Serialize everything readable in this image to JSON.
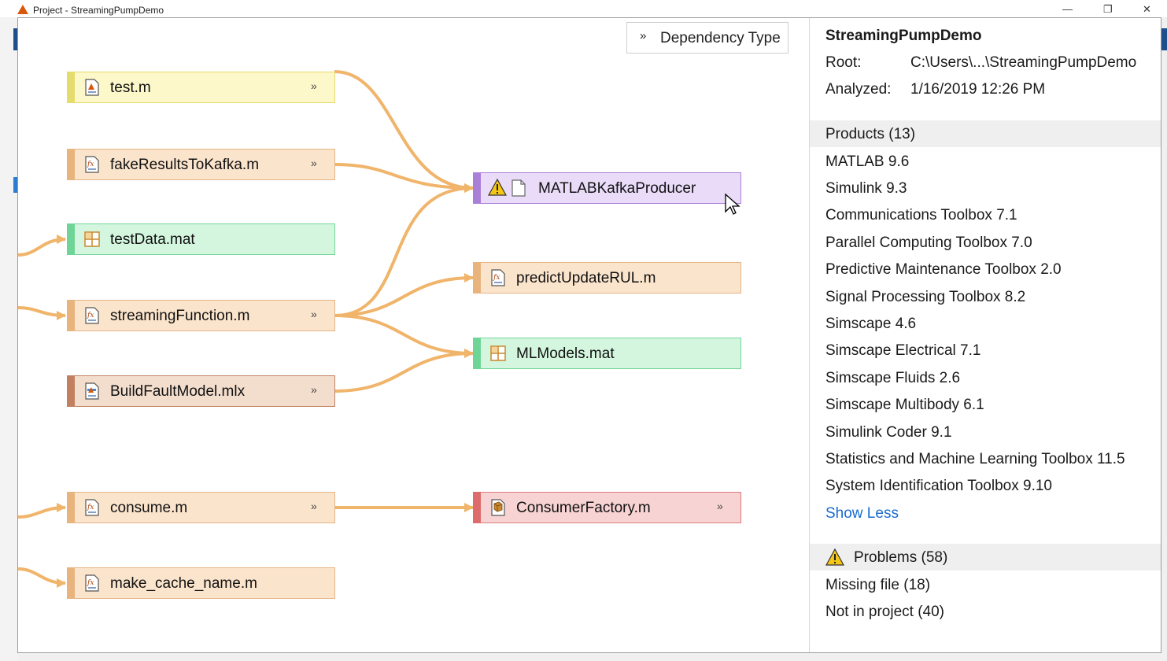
{
  "window": {
    "title": "Project - StreamingPumpDemo",
    "controls": [
      "—",
      "❐",
      "✕"
    ]
  },
  "toolbar": {
    "dependency_type_label": "Dependency Type"
  },
  "graph": {
    "nodes": [
      {
        "id": "test",
        "label": "test.m",
        "type": "script",
        "expandable": true
      },
      {
        "id": "fake",
        "label": "fakeResultsToKafka.m",
        "type": "function",
        "expandable": true
      },
      {
        "id": "testdata",
        "label": "testData.mat",
        "type": "mat",
        "expandable": false
      },
      {
        "id": "streaming",
        "label": "streamingFunction.m",
        "type": "function",
        "expandable": true
      },
      {
        "id": "buildfault",
        "label": "BuildFaultModel.mlx",
        "type": "livescript",
        "expandable": true
      },
      {
        "id": "consume",
        "label": "consume.m",
        "type": "function",
        "expandable": true
      },
      {
        "id": "makecache",
        "label": "make_cache_name.m",
        "type": "function",
        "expandable": false
      },
      {
        "id": "producer",
        "label": "MATLABKafkaProducer",
        "type": "missing",
        "expandable": false
      },
      {
        "id": "predict",
        "label": "predictUpdateRUL.m",
        "type": "function",
        "expandable": false
      },
      {
        "id": "mlmodels",
        "label": "MLModels.mat",
        "type": "mat",
        "expandable": false
      },
      {
        "id": "consumerfactory",
        "label": "ConsumerFactory.m",
        "type": "class",
        "expandable": true
      }
    ],
    "edges": [
      {
        "from": "test",
        "to": "producer"
      },
      {
        "from": "fake",
        "to": "producer"
      },
      {
        "from": "streaming",
        "to": "producer"
      },
      {
        "from": "streaming",
        "to": "predict"
      },
      {
        "from": "streaming",
        "to": "mlmodels"
      },
      {
        "from": "buildfault",
        "to": "mlmodels"
      },
      {
        "from": "consume",
        "to": "consumerfactory"
      },
      {
        "from": "(offscreen)",
        "to": "testdata"
      },
      {
        "from": "(offscreen)",
        "to": "streaming"
      },
      {
        "from": "(offscreen)",
        "to": "consume"
      },
      {
        "from": "(offscreen)",
        "to": "makecache"
      }
    ],
    "colors": {
      "edge": "#f0b46a",
      "script_bar": "#e4dc6c",
      "function_bar": "#e9b37e",
      "mat_bar": "#6fd596",
      "livescript_bar": "#c28060",
      "missing_bar": "#a97fd8",
      "class_bar": "#dd6d6d"
    }
  },
  "details": {
    "project_name": "StreamingPumpDemo",
    "root_label": "Root:",
    "root_value": "C:\\Users\\...\\StreamingPumpDemo",
    "analyzed_label": "Analyzed:",
    "analyzed_value": "1/16/2019 12:26 PM",
    "products_header": "Products (13)",
    "products": [
      "MATLAB 9.6",
      "Simulink 9.3",
      "Communications Toolbox 7.1",
      "Parallel Computing Toolbox 7.0",
      "Predictive Maintenance Toolbox 2.0",
      "Signal Processing Toolbox 8.2",
      "Simscape 4.6",
      "Simscape Electrical 7.1",
      "Simscape Fluids 2.6",
      "Simscape Multibody 6.1",
      "Simulink Coder 9.1",
      "Statistics and Machine Learning Toolbox 11.5",
      "System Identification Toolbox 9.10"
    ],
    "show_less": "Show Less",
    "problems_header": "Problems (58)",
    "problems": [
      "Missing file (18)",
      "Not in project (40)"
    ]
  }
}
